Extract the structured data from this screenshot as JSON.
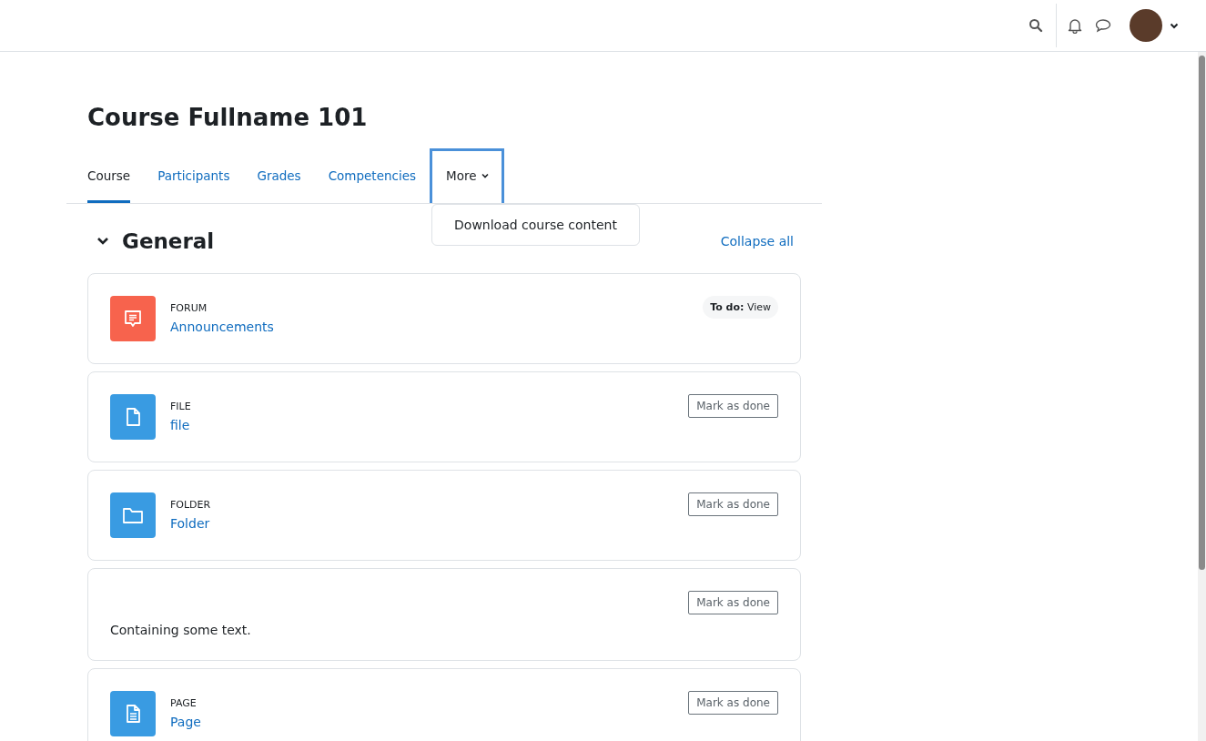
{
  "course_title": "Course Fullname 101",
  "tabs": [
    {
      "label": "Course",
      "selected": true
    },
    {
      "label": "Participants",
      "selected": false
    },
    {
      "label": "Grades",
      "selected": false
    },
    {
      "label": "Competencies",
      "selected": false
    },
    {
      "label": "More",
      "selected": false,
      "kind": "dropdown",
      "expanded": true,
      "menu": [
        "Download course content"
      ]
    }
  ],
  "section": {
    "title": "General",
    "expanded": true,
    "collapse_link": "Collapse all"
  },
  "activities": [
    {
      "kind": "forum",
      "type_label": "FORUM",
      "name": "Announcements",
      "completion": {
        "kind": "todo",
        "text": "**To do:** View"
      }
    },
    {
      "kind": "file",
      "type_label": "FILE",
      "name": "file",
      "completion": {
        "kind": "manual",
        "text": "Mark as done"
      }
    },
    {
      "kind": "folder",
      "type_label": "FOLDER",
      "name": "Folder",
      "completion": {
        "kind": "manual",
        "text": "Mark as done"
      }
    },
    {
      "kind": "label",
      "text": "Containing some text.",
      "completion": {
        "kind": "manual",
        "text": "Mark as done"
      }
    },
    {
      "kind": "page",
      "type_label": "PAGE",
      "name": "Page",
      "completion": {
        "kind": "manual",
        "text": "Mark as done"
      }
    }
  ]
}
